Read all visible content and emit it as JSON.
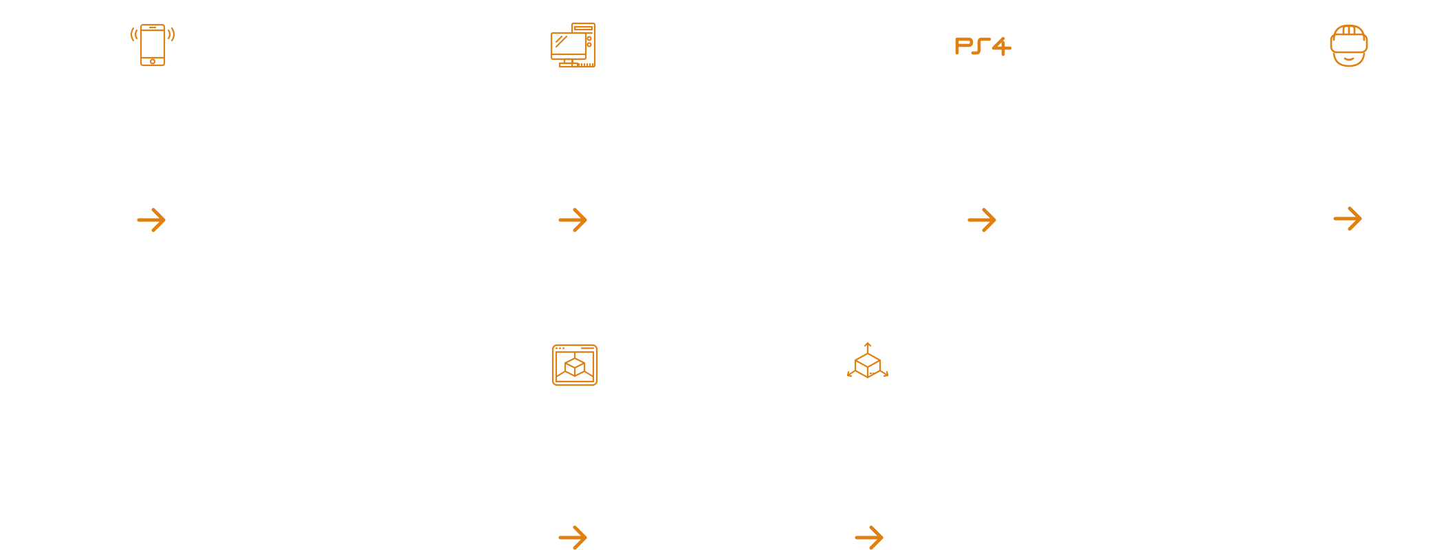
{
  "colors": {
    "accent": "#E07F12",
    "background": "#FFFFFF"
  },
  "services": [
    {
      "icon": "mobile-phone-icon",
      "action_icon": "arrow-right-icon"
    },
    {
      "icon": "desktop-computer-icon",
      "action_icon": "arrow-right-icon"
    },
    {
      "icon": "ps4-logo-icon",
      "action_icon": "arrow-right-icon",
      "logo_text": "PS4"
    },
    {
      "icon": "vr-headset-icon",
      "action_icon": "arrow-right-icon"
    },
    {
      "icon": "3d-model-window-icon",
      "action_icon": "arrow-right-icon"
    },
    {
      "icon": "3d-axis-cube-icon",
      "action_icon": "arrow-right-icon"
    }
  ]
}
